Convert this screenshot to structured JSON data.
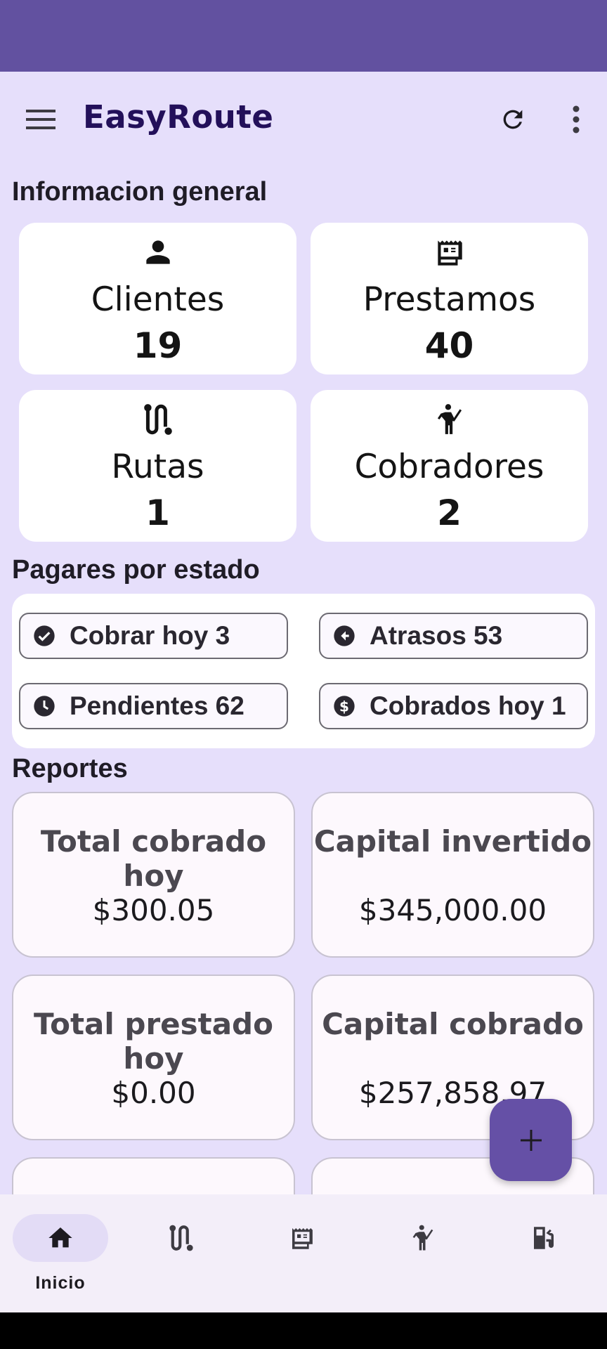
{
  "app": {
    "title": "EasyRoute"
  },
  "colors": {
    "status_bar": "#6251a0",
    "background": "#e6dffb",
    "title": "#23105a",
    "fab": "#6550a6",
    "nav_active": "#e3dcf6"
  },
  "icons": {
    "menu": "hamburger-icon",
    "refresh": "refresh-icon",
    "more": "more-vert-icon",
    "fab": "plus-icon"
  },
  "general": {
    "title": "Informacion general",
    "cards": [
      {
        "label": "Clientes",
        "value": "19",
        "icon": "person-icon"
      },
      {
        "label": "Prestamos",
        "value": "40",
        "icon": "receipt-icon"
      },
      {
        "label": "Rutas",
        "value": "1",
        "icon": "route-icon"
      },
      {
        "label": "Cobradores",
        "value": "2",
        "icon": "collector-icon"
      }
    ]
  },
  "pagares": {
    "title": "Pagares por estado",
    "chips": [
      {
        "label": "Cobrar hoy 3",
        "icon": "check-circle-icon"
      },
      {
        "label": "Atrasos 53",
        "icon": "back-arrow-circle-icon"
      },
      {
        "label": "Pendientes 62",
        "icon": "clock-icon"
      },
      {
        "label": "Cobrados hoy 1",
        "icon": "dollar-circle-icon"
      }
    ]
  },
  "reports": {
    "title": "Reportes",
    "cards": [
      {
        "title": "Total cobrado hoy",
        "value": "$300.05"
      },
      {
        "title": "Capital invertido",
        "value": "$345,000.00"
      },
      {
        "title": "Total prestado hoy",
        "value": "$0.00"
      },
      {
        "title": "Capital cobrado",
        "value": "$257,858.97"
      }
    ]
  },
  "bottom_nav": {
    "items": [
      {
        "label": "Inicio",
        "icon": "home-icon",
        "active": true
      },
      {
        "label": "",
        "icon": "route-icon",
        "active": false
      },
      {
        "label": "",
        "icon": "receipt-icon",
        "active": false
      },
      {
        "label": "",
        "icon": "collector-icon",
        "active": false
      },
      {
        "label": "",
        "icon": "fuel-icon",
        "active": false
      }
    ]
  }
}
